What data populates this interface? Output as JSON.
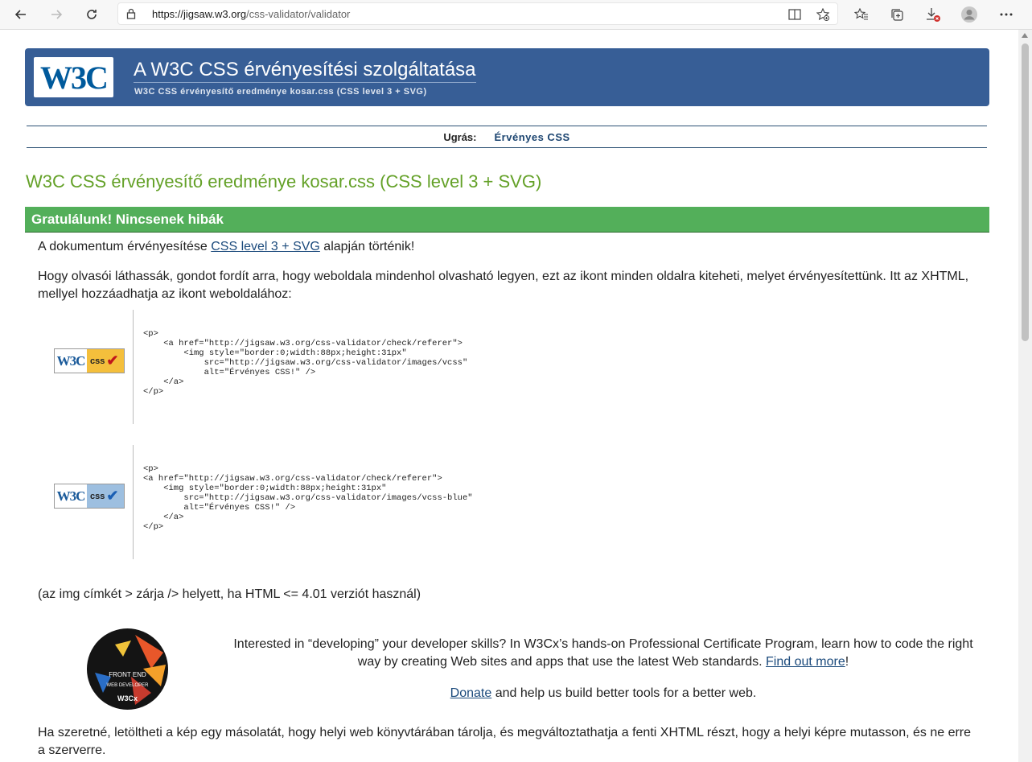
{
  "browser": {
    "url_host": "https://jigsaw.w3.org",
    "url_path": "/css-validator/validator"
  },
  "banner": {
    "logo_text": "W3C",
    "title": "A W3C CSS érvényesítési szolgáltatása",
    "subtitle": "W3C CSS érvényesítő eredménye kosar.css (CSS level 3 + SVG)"
  },
  "jump": {
    "label": "Ugrás:",
    "link": "Érvényes CSS"
  },
  "heading": "W3C CSS érvényesítő eredménye kosar.css (CSS level 3 + SVG)",
  "congrats": "Gratulálunk! Nincsenek hibák",
  "para1": {
    "before": "A dokumentum érvényesítése ",
    "link": "CSS level 3 + SVG",
    "after": " alapján történik!"
  },
  "para2": "Hogy olvasói láthassák, gondot fordít arra, hogy weboldala mindenhol olvasható legyen, ezt az ikont minden oldalra kiteheti, melyet érvényesítettünk. Itt az XHTML, mellyel hozzáadhatja az ikont weboldalához:",
  "badges": [
    {
      "w3c": "W3C",
      "css": "css",
      "check": "✔",
      "check_color": "#c0161b",
      "bg": "#f4bf3c",
      "code": "<p>\n    <a href=\"http://jigsaw.w3.org/css-validator/check/referer\">\n        <img style=\"border:0;width:88px;height:31px\"\n            src=\"http://jigsaw.w3.org/css-validator/images/vcss\"\n            alt=\"Érvényes CSS!\" />\n    </a>\n</p>"
    },
    {
      "w3c": "W3C",
      "css": "css",
      "check": "✔",
      "check_color": "#1a5fb4",
      "bg": "#9dbfe0",
      "code": "<p>\n<a href=\"http://jigsaw.w3.org/css-validator/check/referer\">\n    <img style=\"border:0;width:88px;height:31px\"\n        src=\"http://jigsaw.w3.org/css-validator/images/vcss-blue\"\n        alt=\"Érvényes CSS!\" />\n    </a>\n</p>"
    }
  ],
  "note": "(az img címkét > zárja /> helyett, ha HTML <= 4.01 verziót használ)",
  "promo": {
    "logo_lines": [
      "FRONT END",
      "WEB DEVELOPER",
      "W3Cx"
    ],
    "text": "Interested in “developing” your developer skills? In W3Cx’s hands-on Professional Certificate Program, learn how to code the right way by creating Web sites and apps that use the latest Web standards. ",
    "link": "Find out more",
    "after": "!"
  },
  "donate": {
    "link": "Donate",
    "text": " and help us build better tools for a better web."
  },
  "para3": "Ha szeretné, letöltheti a kép egy másolatát, hogy helyi web könyvtárában tárolja, és megváltoztathatja a fenti XHTML részt, hogy a helyi képre mutasson, és ne erre a szerverre."
}
